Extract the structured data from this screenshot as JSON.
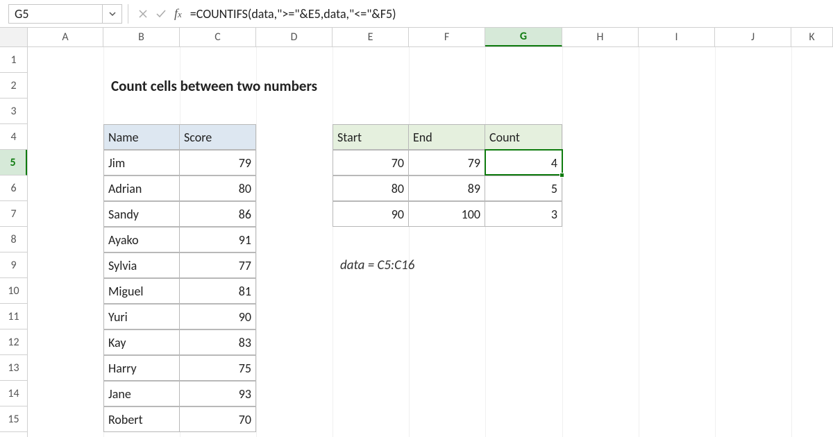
{
  "nameBox": "G5",
  "formula": "=COUNTIFS(data,\">=\"&E5,data,\"<=\"&F5)",
  "columns": [
    "A",
    "B",
    "C",
    "D",
    "E",
    "F",
    "G",
    "H",
    "I",
    "J",
    "K"
  ],
  "rows": [
    "1",
    "2",
    "3",
    "4",
    "5",
    "6",
    "7",
    "8",
    "9",
    "10",
    "11",
    "12",
    "13",
    "14",
    "15"
  ],
  "activeCol": "G",
  "activeRow": "5",
  "title": "Count cells between two numbers",
  "table1": {
    "headers": {
      "name": "Name",
      "score": "Score"
    },
    "rows": [
      {
        "name": "Jim",
        "score": "79"
      },
      {
        "name": "Adrian",
        "score": "80"
      },
      {
        "name": "Sandy",
        "score": "86"
      },
      {
        "name": "Ayako",
        "score": "91"
      },
      {
        "name": "Sylvia",
        "score": "77"
      },
      {
        "name": "Miguel",
        "score": "81"
      },
      {
        "name": "Yuri",
        "score": "90"
      },
      {
        "name": "Kay",
        "score": "83"
      },
      {
        "name": "Harry",
        "score": "75"
      },
      {
        "name": "Jane",
        "score": "93"
      },
      {
        "name": "Robert",
        "score": "70"
      }
    ]
  },
  "table2": {
    "headers": {
      "start": "Start",
      "end": "End",
      "count": "Count"
    },
    "rows": [
      {
        "start": "70",
        "end": "79",
        "count": "4"
      },
      {
        "start": "80",
        "end": "89",
        "count": "5"
      },
      {
        "start": "90",
        "end": "100",
        "count": "3"
      }
    ]
  },
  "note": "data = C5:C16"
}
